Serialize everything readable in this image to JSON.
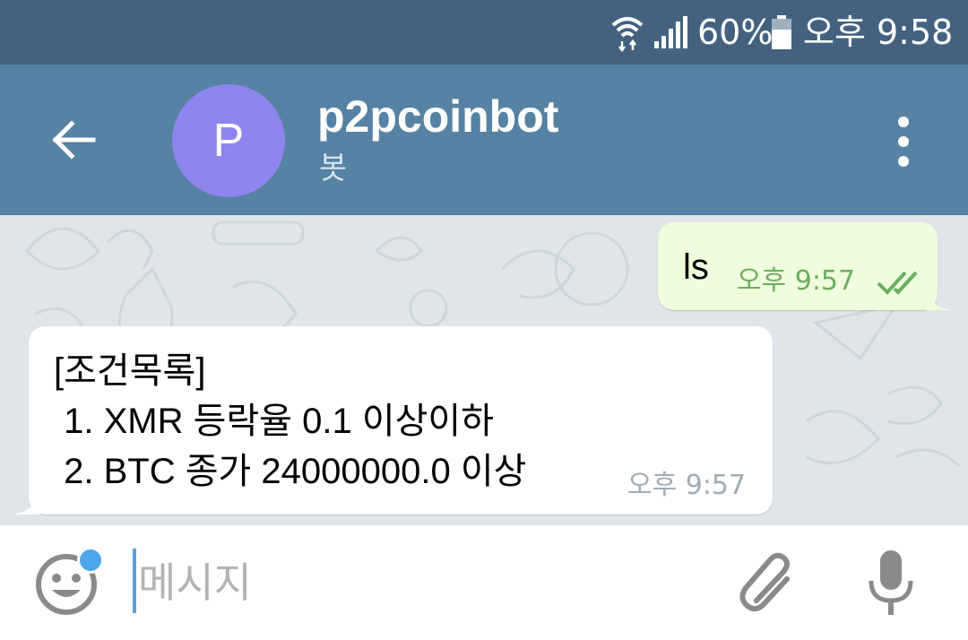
{
  "status_bar": {
    "battery_percent": "60%",
    "clock": "오후 9:58",
    "icons": [
      "wifi-icon",
      "signal-icon",
      "battery-icon"
    ]
  },
  "header": {
    "avatar_letter": "P",
    "avatar_color": "#8e85ee",
    "title": "p2pcoinbot",
    "subtitle": "봇",
    "icons": [
      "back-arrow-icon",
      "more-vertical-icon"
    ]
  },
  "messages": [
    {
      "direction": "outgoing",
      "text": "ls",
      "time": "오후 9:57",
      "status": "read",
      "status_icon": "double-check-icon"
    },
    {
      "direction": "incoming",
      "lines": [
        "[조건목록]",
        " 1. XMR 등락율 0.1 이상이하",
        " 2. BTC 종가 24000000.0 이상"
      ],
      "time": "오후 9:57"
    }
  ],
  "input_bar": {
    "placeholder": "메시지",
    "icons": [
      "emoji-icon",
      "paperclip-icon",
      "microphone-icon"
    ]
  },
  "colors": {
    "status_bar": "#44627f",
    "app_bar": "#5682a3",
    "outgoing_bubble": "#effdde",
    "outgoing_time": "#6cae5e",
    "incoming_time": "#a0acb6",
    "notification_dot": "#4ea6ea"
  }
}
